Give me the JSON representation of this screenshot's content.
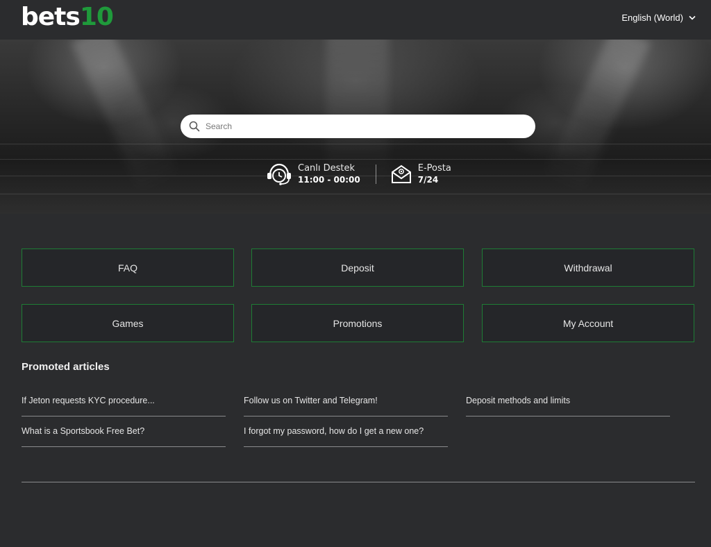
{
  "header": {
    "logo_text": "bets",
    "logo_number": "10",
    "language": "English (World)"
  },
  "search": {
    "placeholder": "Search"
  },
  "support": {
    "live": {
      "title": "Canlı Destek",
      "value": "11:00 - 00:00",
      "icon": "headset-clock-icon"
    },
    "email": {
      "title": "E-Posta",
      "value": "7/24",
      "icon": "envelope-icon"
    }
  },
  "categories": [
    "FAQ",
    "Deposit",
    "Withdrawal",
    "Games",
    "Promotions",
    "My Account"
  ],
  "promoted": {
    "title": "Promoted articles",
    "articles": [
      "If Jeton requests KYC procedure...",
      "Follow us on Twitter and Telegram!",
      "Deposit methods and limits",
      "What is a Sportsbook Free Bet?",
      "I forgot my password, how do I get a new one?"
    ]
  },
  "colors": {
    "background": "#2b2c2e",
    "accent": "#1f9a3b",
    "tile_border": "#1e7d35"
  }
}
